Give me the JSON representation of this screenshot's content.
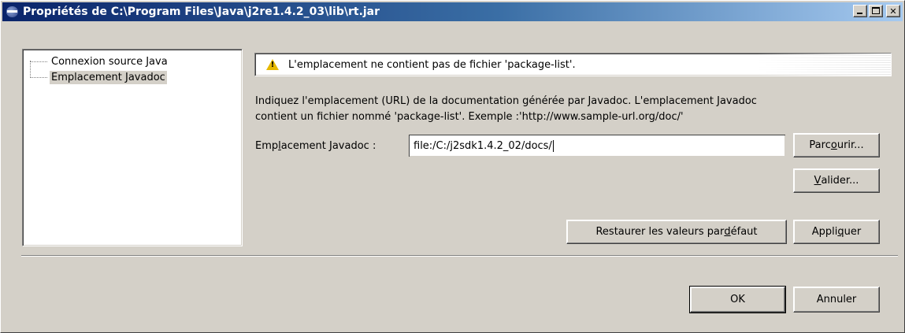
{
  "window": {
    "title": "Propriétés de C:\\Program Files\\Java\\j2re1.4.2_03\\lib\\rt.jar",
    "icon": "eclipse-icon"
  },
  "tree": {
    "items": [
      {
        "label": "Connexion source Java",
        "selected": false
      },
      {
        "label": "Emplacement Javadoc",
        "selected": true
      }
    ]
  },
  "message": {
    "icon": "warning-icon",
    "text": "L'emplacement ne contient pas de fichier 'package-list'."
  },
  "description": {
    "line1": "Indiquez l'emplacement (URL) de la documentation générée par Javadoc. L'emplacement Javadoc",
    "line2": "contient un fichier nommé 'package-list'. Exemple :'http://www.sample-url.org/doc/'"
  },
  "field": {
    "label_pre": "Emp",
    "label_mnemonic": "l",
    "label_post": "acement Javadoc :",
    "value": "file:/C:/j2sdk1.4.2_02/docs/"
  },
  "buttons": {
    "browse": {
      "pre": "Parc",
      "mnemonic": "o",
      "post": "urir..."
    },
    "validate": {
      "pre": "",
      "mnemonic": "V",
      "post": "alider..."
    },
    "restore": {
      "pre": "Restaurer les valeurs par ",
      "mnemonic": "d",
      "post": "éfaut"
    },
    "apply": {
      "pre": "Appli",
      "mnemonic": "q",
      "post": "uer"
    },
    "ok": "OK",
    "cancel": "Annuler"
  }
}
